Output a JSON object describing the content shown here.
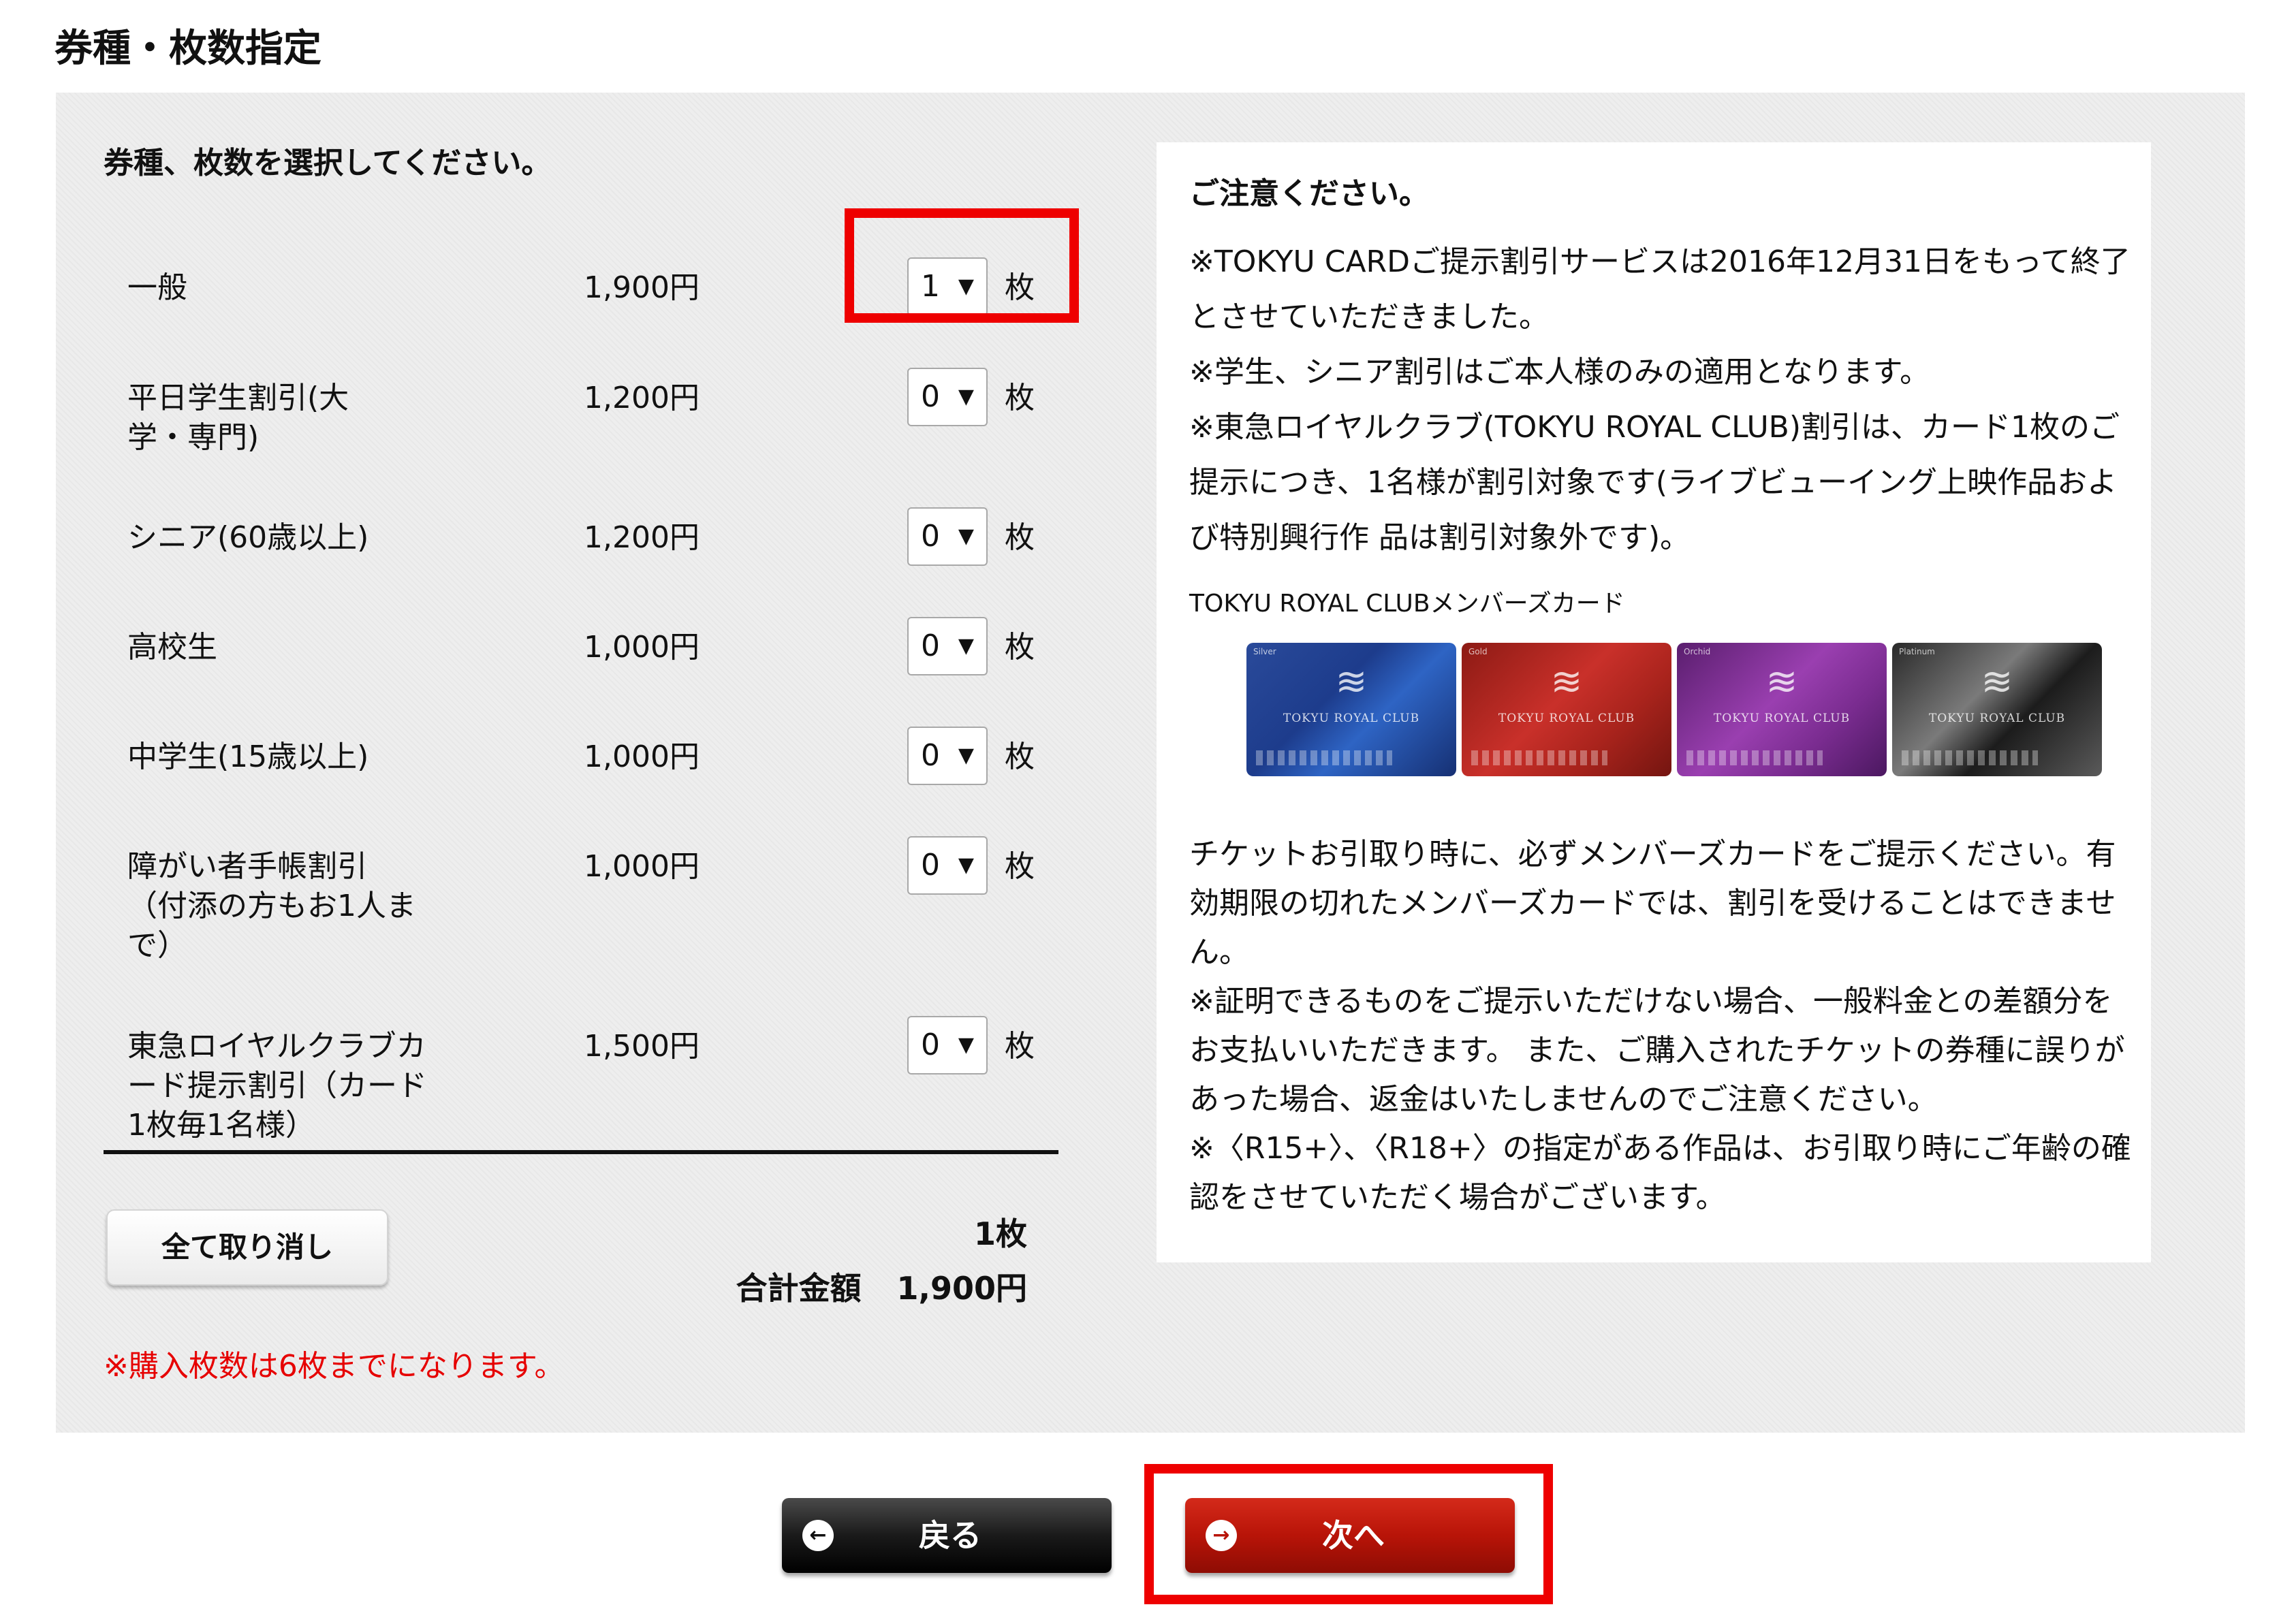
{
  "page_title": "券種・枚数指定",
  "instruction": "券種、枚数を選択してください。",
  "tickets": [
    {
      "name": "一般",
      "price": "1,900円",
      "qty": "1"
    },
    {
      "name": "平日学生割引(大学・専門)",
      "price": "1,200円",
      "qty": "0"
    },
    {
      "name": "シニア(60歳以上)",
      "price": "1,200円",
      "qty": "0"
    },
    {
      "name": "高校生",
      "price": "1,000円",
      "qty": "0"
    },
    {
      "name": "中学生(15歳以上)",
      "price": "1,000円",
      "qty": "0"
    },
    {
      "name": "障がい者手帳割引（付添の方もお1人まで）",
      "price": "1,000円",
      "qty": "0"
    },
    {
      "name": "東急ロイヤルクラブカード提示割引（カード1枚毎1名様）",
      "price": "1,500円",
      "qty": "0"
    }
  ],
  "qty_unit": "枚",
  "clear_button_label": "全て取り消し",
  "total": {
    "count": "1枚",
    "label": "合計金額",
    "amount": "1,900円"
  },
  "limit_note": "※購入枚数は6枚までになります。",
  "notice": {
    "title": "ご注意ください。",
    "paragraphs_top": [
      "※TOKYU CARDご提示割引サービスは2016年12月31日をもって終了とさせていただきました。",
      "※学生、シニア割引はご本人様のみの適用となります。",
      "※東急ロイヤルクラブ(TOKYU ROYAL CLUB)割引は、カード1枚のご提示につき、1名様が割引対象です(ライブビューイング上映作品および特別興行作 品は割引対象外です)。"
    ],
    "card_caption": "TOKYU ROYAL CLUBメンバーズカード",
    "cards": [
      {
        "grade": "Silver",
        "brand": "TOKYU ROYAL CLUB",
        "color": "#1d3c8c"
      },
      {
        "grade": "Gold",
        "brand": "TOKYU ROYAL CLUB",
        "color": "#c9302a"
      },
      {
        "grade": "Orchid",
        "brand": "TOKYU ROYAL CLUB",
        "color": "#9a3fb0"
      },
      {
        "grade": "Platinum",
        "brand": "TOKYU ROYAL CLUB",
        "color": "#1c1c1c"
      }
    ],
    "paragraphs_bottom": [
      "チケットお引取り時に、必ずメンバーズカードをご提示ください。有効期限の切れたメンバーズカードでは、割引を受けることはできません。",
      "※証明できるものをご提示いただけない場合、一般料金との差額分をお支払いいただきます。 また、ご購入されたチケットの券種に誤りがあった場合、返金はいたしませんのでご注意ください。",
      "※〈R15+〉、〈R18+〉の指定がある作品は、お引取り時にご年齢の確認をさせていただく場合がございます。"
    ]
  },
  "nav": {
    "back_label": "戻る",
    "next_label": "次へ"
  },
  "colors": {
    "highlight": "#ee0000",
    "warning_text": "#e60000",
    "next_button": "#b81408",
    "back_button": "#1a1a1a",
    "panel_bg": "#eeeeee"
  },
  "icons": {
    "qty_dropdown": "chevron-down-icon",
    "back": "arrow-left-circle-icon",
    "next": "arrow-right-circle-icon"
  }
}
